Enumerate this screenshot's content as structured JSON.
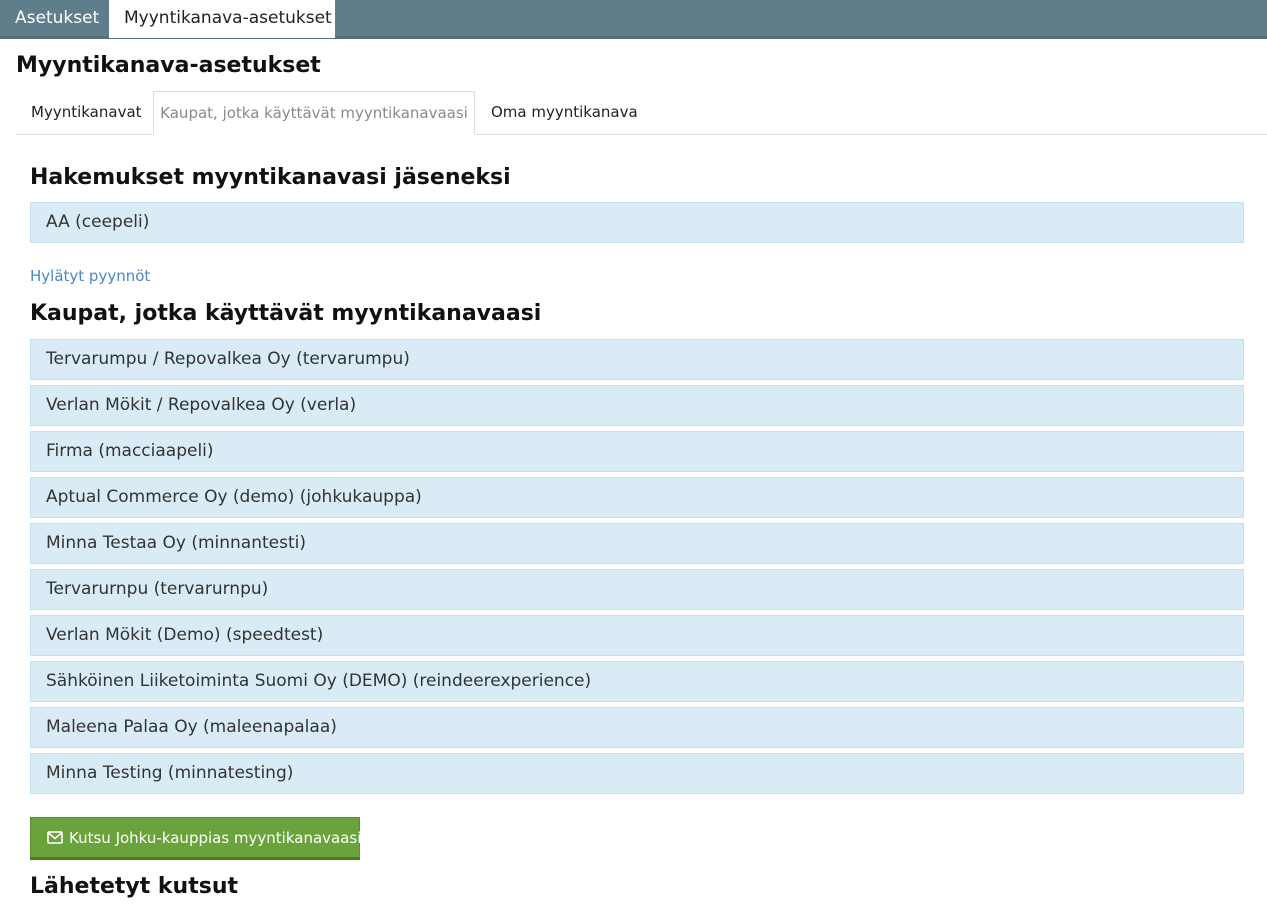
{
  "top_tabs": [
    {
      "label": "Asetukset"
    },
    {
      "label": "Myyntikanava-asetukset"
    }
  ],
  "page_title": "Myyntikanava-asetukset",
  "sub_tabs": [
    {
      "label": "Myyntikanavat"
    },
    {
      "label": "Kaupat, jotka käyttävät myyntikanavaasi",
      "active": true
    },
    {
      "label": "Oma myyntikanava"
    }
  ],
  "applications": {
    "heading": "Hakemukset myyntikanavasi jäseneksi",
    "items": [
      "AA (ceepeli)"
    ],
    "rejected_link": "Hylätyt pyynnöt"
  },
  "shops": {
    "heading": "Kaupat, jotka käyttävät myyntikanavaasi",
    "items": [
      "Tervarumpu / Repovalkea Oy (tervarumpu)",
      "Verlan Mökit / Repovalkea Oy (verla)",
      "Firma (macciaapeli)",
      "Aptual Commerce Oy (demo) (johkukauppa)",
      "Minna Testaa Oy (minnantesti)",
      "Tervarurnpu (tervarurnpu)",
      "Verlan Mökit (Demo) (speedtest)",
      "Sähköinen Liiketoiminta Suomi Oy (DEMO) (reindeerexperience)",
      "Maleena Palaa Oy (maleenapalaa)",
      "Minna Testing (minnatesting)"
    ],
    "invite_button": "Kutsu Johku-kauppias myyntikanavaasi",
    "invite_icon": "envelope-icon"
  },
  "sent_invites": {
    "heading": "Lähetetyt kutsut"
  },
  "colors": {
    "topbar": "#607d8b",
    "row_background": "#d9ecf5",
    "row_border": "#c4e1ef",
    "link": "#4a86c5",
    "button": "#6aa33b"
  }
}
